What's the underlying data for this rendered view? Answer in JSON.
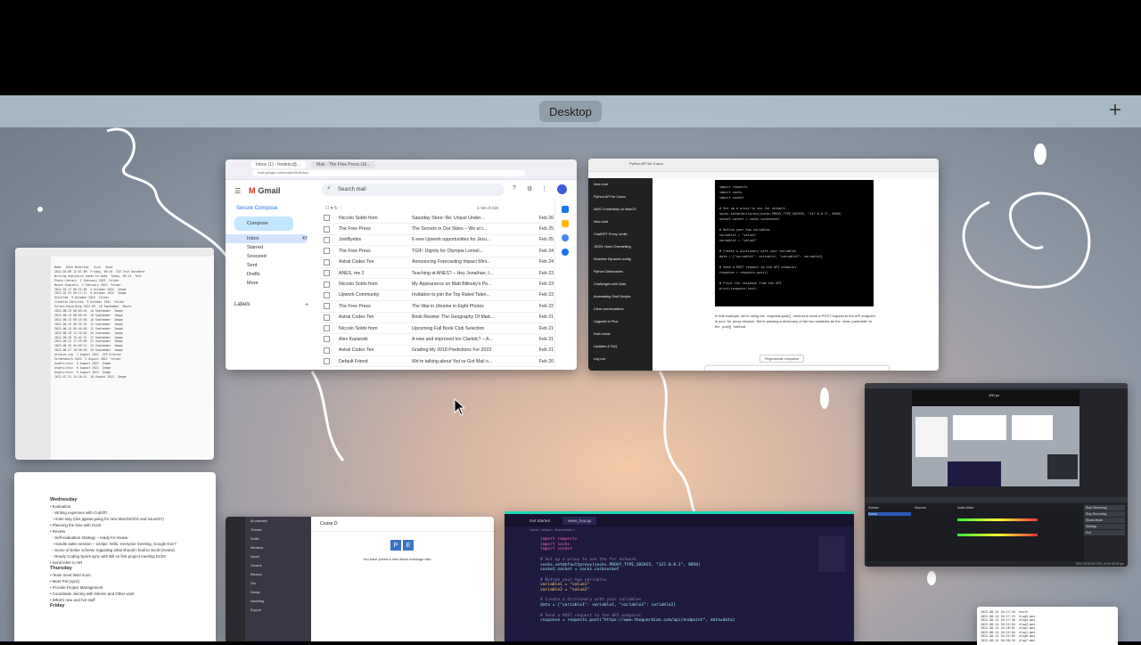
{
  "mission_control": {
    "desktop_label": "Desktop",
    "add_space_glyph": "+"
  },
  "gmail": {
    "tabs": [
      "Inbox (1) - frederic@...",
      "Mail - The Free Press Lib..."
    ],
    "url": "mail.google.com/mail/u/0/#inbox",
    "brand": "Gmail",
    "search_placeholder": "Search mail",
    "secure_compose": "Secure Compose",
    "compose": "Compose",
    "nav": [
      {
        "label": "Inbox",
        "count": "47"
      },
      {
        "label": "Starred",
        "count": ""
      },
      {
        "label": "Snoozed",
        "count": ""
      },
      {
        "label": "Sent",
        "count": ""
      },
      {
        "label": "Drafts",
        "count": ""
      },
      {
        "label": "More",
        "count": ""
      }
    ],
    "labels_heading": "Labels",
    "pagination": "1–50 of 219",
    "rows": [
      {
        "from": "Niccolo Soldo from",
        "subject": "Saturday Store: Re: Unjust Under...",
        "date": "Feb 26"
      },
      {
        "from": "The Free Press",
        "subject": "The Secrets in Our Skies – We at t...",
        "date": "Feb 25"
      },
      {
        "from": "JoinByebis",
        "subject": "6 new Upwork opportunities for Jesu...",
        "date": "Feb 25"
      },
      {
        "from": "The Free Press",
        "subject": "TGIF: Dignity for Olympia Lonnel...",
        "date": "Feb 24"
      },
      {
        "from": "Astral Codex Ten",
        "subject": "Announcing Forecasting Impact Mini...",
        "date": "Feb 24"
      },
      {
        "from": "ANES, me 2",
        "subject": "Teaching at ANES? – Hey Jonathan, I...",
        "date": "Feb 23"
      },
      {
        "from": "Niccolo Soldo from",
        "subject": "My Appearance on Matt Bilinsky's Po...",
        "date": "Feb 23"
      },
      {
        "from": "Upwork Community",
        "subject": "Invitation to join the Top Rated Talen...",
        "date": "Feb 23"
      },
      {
        "from": "The Free Press",
        "subject": "The War in Ukraine in Eight Photos",
        "date": "Feb 22"
      },
      {
        "from": "Astral Codex Ten",
        "subject": "Book Review: The Geography Of Mad...",
        "date": "Feb 21"
      },
      {
        "from": "Niccolo Soldo from",
        "subject": "Upcoming Fall Book Club Selection",
        "date": "Feb 21"
      },
      {
        "from": "Alex Kazanski",
        "subject": "A new and improved ton Clarkdc? – A...",
        "date": "Feb 21"
      },
      {
        "from": "Astral Codex Ten",
        "subject": "Grading My 2018 Predictions For 2023",
        "date": "Feb 21"
      },
      {
        "from": "Default Friend",
        "subject": "We're talking about You've Got Mail o...",
        "date": "Feb 20"
      },
      {
        "from": "The Free Press",
        "subject": "Why Students in Kentucky Have Bee...",
        "date": "Feb 20"
      }
    ]
  },
  "chatgpt": {
    "tab": "Python API for Cosco",
    "sidebar": [
      "New chat",
      "Python API for Cosco",
      "AWS Credentials on MacOS",
      "New chat",
      "ChatGPT Proxy Limits",
      "JSON: None Overwriting",
      "Reactive Dynamic config",
      "Python Dictionaries",
      "Challenges with Data",
      "Automating Shell Scripts",
      "Clear conversations",
      "Upgrade to Plus",
      "Dark mode",
      "Updates & FAQ",
      "Log out"
    ],
    "code": "import requests\nimport socks\nimport socket\n\n# Set up a proxy to use for network\nsocks.setdefaultproxy(socks.PROXY_TYPE_SOCKS5, \"127.0.0.1\", 9050)\nsocket.socket = socks.socksocket\n\n# Define your two variables\nvariable1 = \"value1\"\nvariable2 = \"value2\"\n\n# Create a dictionary with your variables\ndata = {\"variable1\": variable1, \"variable2\": variable2}\n\n# Send a POST request to the API endpoint\nresponse = requests.post()\n\n# Print the response from the API\nprint(response.text)",
    "explanation": "In this example, we're using the `requests.post()` method to send a POST request to the API endpoint in your Tor proxy session. We're passing a dictionary of the two variables as the `data` parameter to the `post()` method.",
    "regenerate": "Regenerate response"
  },
  "obs": {
    "overlay_label": "100 px",
    "scenes_label": "Scenes",
    "sources_label": "Sources",
    "mixer_label": "Audio Mixer",
    "controls": [
      "Start Streaming",
      "Stop Recording",
      "Studio Mode",
      "Settings",
      "Exit"
    ],
    "status": "REC 00:00:00  CPU: 4.0%  30.00 fps"
  },
  "vscode": {
    "tab_getting_started": "Get Started",
    "tab_file": "news_hxu.py",
    "breadcrumb": "Users > eliana > Documents > ...",
    "code_lines": [
      {
        "t": "kw",
        "s": "import requests"
      },
      {
        "t": "kw",
        "s": "import socks"
      },
      {
        "t": "kw",
        "s": "import socket"
      },
      {
        "t": "",
        "s": ""
      },
      {
        "t": "cm",
        "s": "# Set up a proxy to use the for network"
      },
      {
        "t": "",
        "s": "socks.setdefaultproxy(socks.PROXY_TYPE_SOCKS5, \"127.0.0.1\", 9050)"
      },
      {
        "t": "",
        "s": "socket.socket = socks.socksocket"
      },
      {
        "t": "",
        "s": ""
      },
      {
        "t": "cm",
        "s": "# Define your two variables"
      },
      {
        "t": "str",
        "s": "variable1 = \"value1\""
      },
      {
        "t": "str",
        "s": "variable2 = \"value2\""
      },
      {
        "t": "",
        "s": ""
      },
      {
        "t": "cm",
        "s": "# Create a dictionary with your variables"
      },
      {
        "t": "",
        "s": "data = {\"variable1\": variable1, \"variable2\": variable2}"
      },
      {
        "t": "",
        "s": ""
      },
      {
        "t": "cm",
        "s": "# Send a POST request to the API endpoint"
      },
      {
        "t": "",
        "s": "response = requests.post(\"https://www.theguardian.com/api/endpoint\", data=data)"
      }
    ]
  },
  "slack": {
    "title": "Cruise D",
    "avatars": [
      "P",
      "E"
    ],
    "message": "You have joined a new direct message with",
    "channels": [
      "All channels",
      "Threads",
      "Drafts",
      "Mentions",
      "Saved",
      "General",
      "Random",
      "Dev",
      "Design",
      "Marketing",
      "Support"
    ]
  },
  "notes": {
    "lines": [
      "Wednesday",
      "• Evaluation",
      "  ◦ Writing expenses with Codoft?",
      "  ◦ Hotel stay (dos jigsaw going for new MacOS/iOS and sounds?)",
      "• Planning the time with Scott",
      "• Review",
      "  ◦ Self-evaluation strategy – ready for review",
      "  ◦ Handle sales session – ezelpe: hello, everyone meeting, Google Doc?",
      "  ◦ Some of better scheme regarding what should I hold to Scott (review)",
      "  ◦ Ready Coding Sprint sync with Bill on first project meeting 01/20",
      "• Send letter to HR",
      "",
      "Thursday",
      "• Team meet Wed noon",
      "• Meet Pol (sync)",
      "• Provide Project Management",
      "• Coordinate Jammy with Steven and Other work",
      "• What's new and hot stuff",
      "",
      "Friday"
    ]
  },
  "finder": {
    "columns": [
      "Name",
      "Date Modified",
      "Size",
      "Kind"
    ],
    "rows": [
      "2022-03-09 12:07 AM  Friday, 06:16  CSV Text Document",
      "Writing explosive ideas to make  Today, 03:13  Text",
      "Photo Library  2 February 2023  Folder",
      "Movie Chapters  2 February 2023  Folder",
      "2022-03-17 06:21:05  4 October 2022  Image",
      "2022-03-25 09:17:11  8 October 2022  Image",
      "Untitled  9 October 2022  Folder",
      "Creative Services  9 October 2022  Folder",
      "Screen Recording 2022-09  10 September  Movie",
      "2022-08-13 00:05:44  10 September  Image",
      "2022-08-13 00:05:44  10 September  Image",
      "2022-08-13 09:15:56  10 September  Image",
      "2022-08-13 09:31:22  12 September  Image",
      "2022-08-13 09:44:48  12 September  Image",
      "2022-08-19 11:15:02  20 September  Image",
      "2022-08-20 15:41:31  22 September  Image",
      "2022-08-22 17:29:09  22 September  Image",
      "2022-08-25 04:09:11  23 September  Image",
      "2022-08-27 10:56:40  26 September  Image",
      "Archive.zip  1 August 2022  ZIP Archive",
      "Screenshots 2022  3 August 2022  Folder",
      "Angelo.heic  5 August 2022  Image",
      "Angelo.heic  6 August 2022  Image",
      "Angelo.heic  9 August 2022  Image",
      "2022-07-31 14:16:41  10 August 2022  Image"
    ]
  },
  "terminal": {
    "lines": [
      "2022-08-24 10:17:16  hsxfh",
      "2022-08-24 10:17:19  vlog5.mov",
      "2022-08-24 10:17:36  vlog4.mov",
      "2022-08-24 10:22:04  vlog3.mov",
      "2022-08-24 10:18:01  vlog2.mov",
      "2022-08-24 10:22:04  vlog1.mov",
      "2022-08-24 10:22:05  vlog6.mov",
      "2022-08-24 10:30:18  vlog7.mov"
    ]
  },
  "colors": {
    "gmail_red": "#d93025",
    "compose_blue": "#c2e7ff",
    "vscode_accent": "#1ed6b5",
    "desktop_sky": "#8e97a4"
  }
}
